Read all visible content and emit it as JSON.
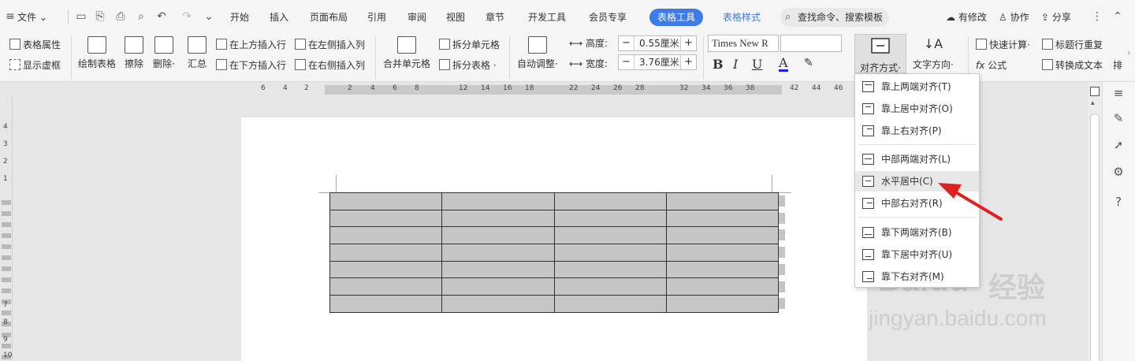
{
  "menubar": {
    "file_label": "文件",
    "tabs": [
      "开始",
      "插入",
      "页面布局",
      "引用",
      "审阅",
      "视图",
      "章节",
      "开发工具",
      "会员专享"
    ],
    "active_tab": "表格工具",
    "style_tab": "表格样式",
    "search_placeholder": "查找命令、搜索模板",
    "modified_label": "有修改",
    "collab_label": "协作",
    "share_label": "分享"
  },
  "ribbon": {
    "table_props": "表格属性",
    "show_gridlines": "显示虚框",
    "draw_table": "绘制表格",
    "erase": "擦除",
    "delete": "删除",
    "summary": "汇总",
    "insert_above": "在上方插入行",
    "insert_below": "在下方插入行",
    "insert_left": "在左侧插入列",
    "insert_right": "在右侧插入列",
    "merge_cells": "合并单元格",
    "split_cells": "拆分单元格",
    "split_table": "拆分表格",
    "auto_fit": "自动调整",
    "height_label": "高度:",
    "height_value": "0.55厘米",
    "width_label": "宽度:",
    "width_value": "3.76厘米",
    "font_name": "Times New R",
    "align_mode": "对齐方式",
    "text_direction": "文字方向",
    "quick_calc": "快速计算",
    "formula": "公式",
    "title_repeat": "标题行重复",
    "convert_text": "转换成文本",
    "sort_partial": "排"
  },
  "ruler": {
    "ticks": [
      "6",
      "4",
      "2",
      "2",
      "4",
      "6",
      "8",
      "12",
      "14",
      "16",
      "18",
      "22",
      "24",
      "26",
      "28",
      "32",
      "34",
      "36",
      "38",
      "42",
      "44",
      "46"
    ],
    "v_ticks": [
      "4",
      "3",
      "2",
      "1",
      "7",
      "8",
      "9",
      "10"
    ]
  },
  "table": {
    "rows": 7,
    "cols": 4
  },
  "dropdown": {
    "items": [
      "靠上两端对齐(T)",
      "靠上居中对齐(O)",
      "靠上右对齐(P)",
      "中部两端对齐(L)",
      "水平居中(C)",
      "中部右对齐(R)",
      "靠下两端对齐(B)",
      "靠下居中对齐(U)",
      "靠下右对齐(M)"
    ],
    "highlighted_index": 4
  },
  "watermark": {
    "logo": "Baidu",
    "cn": "经验",
    "url": "jingyan.baidu.com"
  },
  "colors": {
    "accent": "#3c7be8",
    "arrow": "#e02020"
  }
}
